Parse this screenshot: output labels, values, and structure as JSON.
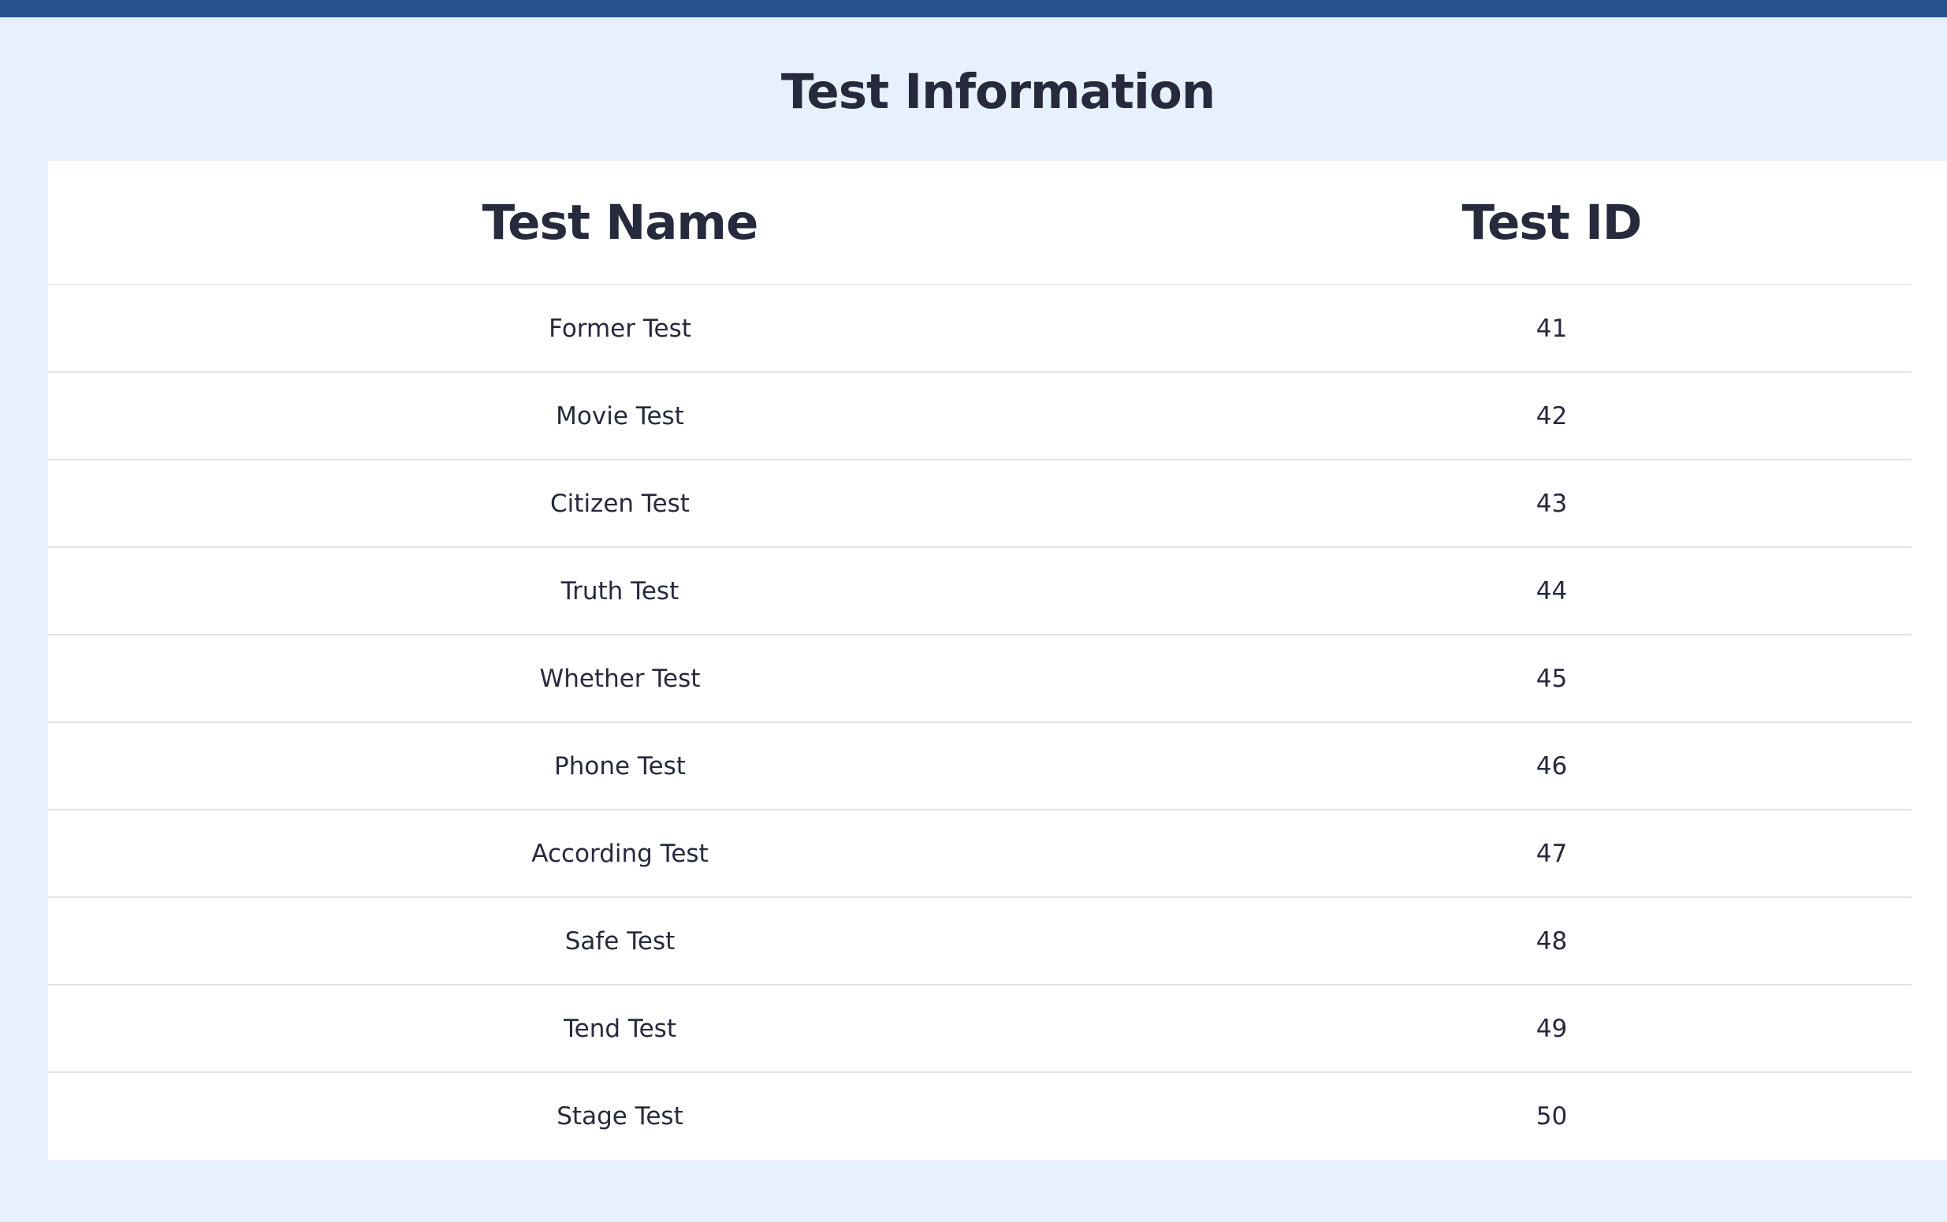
{
  "page": {
    "title": "Test Information"
  },
  "table": {
    "columns": [
      "Test Name",
      "Test ID"
    ],
    "rows": [
      {
        "name": "Former Test",
        "id": "41"
      },
      {
        "name": "Movie Test",
        "id": "42"
      },
      {
        "name": "Citizen Test",
        "id": "43"
      },
      {
        "name": "Truth Test",
        "id": "44"
      },
      {
        "name": "Whether Test",
        "id": "45"
      },
      {
        "name": "Phone Test",
        "id": "46"
      },
      {
        "name": "According Test",
        "id": "47"
      },
      {
        "name": "Safe Test",
        "id": "48"
      },
      {
        "name": "Tend Test",
        "id": "49"
      },
      {
        "name": "Stage Test",
        "id": "50"
      }
    ]
  },
  "colors": {
    "background": "#e6f1fd",
    "top_bar": "#26538b",
    "text": "#272a3d",
    "card": "#ffffff",
    "row_divider": "#e1e3e7"
  }
}
